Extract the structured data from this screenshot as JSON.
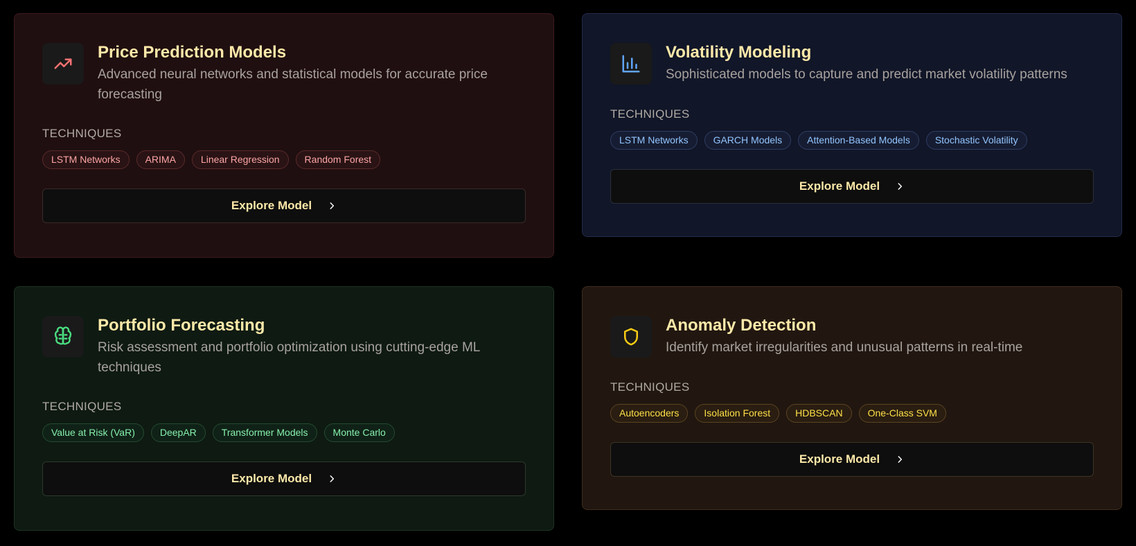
{
  "colors": {
    "background": "#000000",
    "title": "#fde9a9",
    "red_accent": "#f87171",
    "blue_accent": "#60a5fa",
    "green_accent": "#4ade80",
    "orange_accent": "#facc15"
  },
  "cards": [
    {
      "icon": "trending-up-icon",
      "title": "Price Prediction Models",
      "description": "Advanced neural networks and statistical models for accurate price forecasting",
      "techniques_label": "TECHNIQUES",
      "tags": [
        "LSTM Networks",
        "ARIMA",
        "Linear Regression",
        "Random Forest"
      ],
      "button": "Explore Model"
    },
    {
      "icon": "bar-chart-icon",
      "title": "Volatility Modeling",
      "description": "Sophisticated models to capture and predict market volatility patterns",
      "techniques_label": "TECHNIQUES",
      "tags": [
        "LSTM Networks",
        "GARCH Models",
        "Attention-Based Models",
        "Stochastic Volatility"
      ],
      "button": "Explore Model"
    },
    {
      "icon": "brain-icon",
      "title": "Portfolio Forecasting",
      "description": "Risk assessment and portfolio optimization using cutting-edge ML techniques",
      "techniques_label": "TECHNIQUES",
      "tags": [
        "Value at Risk (VaR)",
        "DeepAR",
        "Transformer Models",
        "Monte Carlo"
      ],
      "button": "Explore Model"
    },
    {
      "icon": "shield-icon",
      "title": "Anomaly Detection",
      "description": "Identify market irregularities and unusual patterns in real-time",
      "techniques_label": "TECHNIQUES",
      "tags": [
        "Autoencoders",
        "Isolation Forest",
        "HDBSCAN",
        "One-Class SVM"
      ],
      "button": "Explore Model"
    }
  ]
}
